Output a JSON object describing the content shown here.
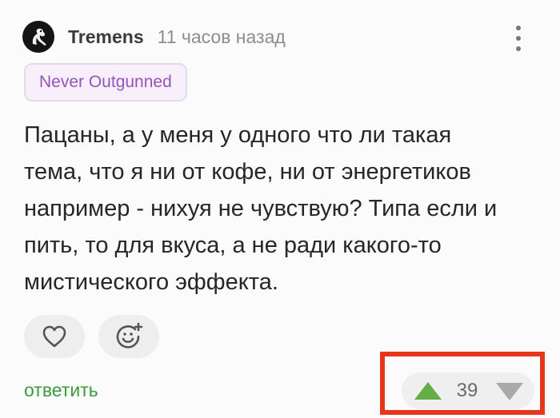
{
  "comment": {
    "author": "Tremens",
    "time": "11 часов назад",
    "badge": "Never Outgunned",
    "text": "Пацаны, а у меня у одного что ли такая\nтема, что я ни от кофе, ни от энергетиков\nнапример - нихуя не чувствую? Типа если и\nпить, то для вкуса, а не ради какого-то\nмистического эффекта."
  },
  "actions": {
    "reply_label": "ответить",
    "like_icon": "heart-icon",
    "reaction_icon": "add-emoji-icon"
  },
  "rating": {
    "score": "39",
    "up_color": "#67ad45",
    "down_color": "#a9a9a9"
  },
  "colors": {
    "badge_text": "#9553bb",
    "reply_text": "#3b9a3b",
    "highlight": "#e8361c"
  }
}
